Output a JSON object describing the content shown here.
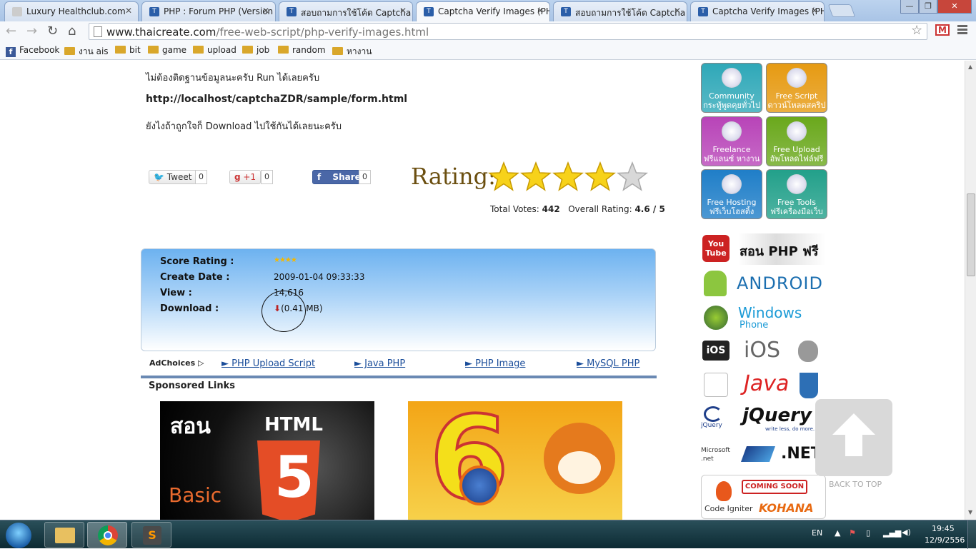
{
  "browser": {
    "tabs": [
      {
        "title": "Luxury Healthclub.com"
      },
      {
        "title": "PHP : Forum PHP (Version"
      },
      {
        "title": "สอบถามการใช้โค้ด Captcha"
      },
      {
        "title": "Captcha Verify Images (PH"
      },
      {
        "title": "สอบถามการใช้โค้ด Captcha"
      },
      {
        "title": "Captcha Verify Images (PH"
      }
    ],
    "url_domain": "www.thaicreate.com",
    "url_path": "/free-web-script/php-verify-images.html",
    "bookmarks": [
      "Facebook",
      "งาน ais",
      "bit",
      "game",
      "upload",
      "job",
      "random",
      "หางาน"
    ]
  },
  "content": {
    "line1": "ไม่ต้องติดฐานข้อมูลนะครับ Run ได้เลยครับ",
    "line2": "http://localhost/captchaZDR/sample/form.html",
    "line3": "ยังไงถ้าถูกใจก็ Download ไปใช้กันได้เลยนะครับ",
    "share": {
      "tweet": "Tweet",
      "tweet_count": "0",
      "gplus": "+1",
      "gplus_count": "0",
      "fb": "Share",
      "fb_count": "0"
    },
    "rating": {
      "label": "Rating:",
      "stars_filled": 4,
      "stars_total": 5,
      "total_votes_label": "Total Votes:",
      "total_votes": "442",
      "overall_label": "Overall Rating:",
      "overall": "4.6 / 5"
    },
    "info": {
      "score_label": "Score Rating :",
      "score_stars": 4,
      "create_label": "Create Date :",
      "create_value": "2009-01-04 09:33:33",
      "view_label": "View :",
      "view_value": "14,616",
      "download_label": "Download :",
      "download_value": "(0.41 MB)"
    },
    "adbar": {
      "adchoices": "AdChoices",
      "links": [
        "► PHP Upload Script",
        "► Java PHP",
        "► PHP Image",
        "► MySQL PHP"
      ]
    },
    "sponsored": "Sponsored Links",
    "banner1": {
      "title": "สอน",
      "word": "HTML",
      "sub": "Basic",
      "num": "5"
    },
    "banner2": {
      "num": "6"
    }
  },
  "sidebar": {
    "buttons": [
      {
        "en": "Community",
        "th": "กระทู้พูดคุยทั่วไป",
        "color": "#2fa8b8"
      },
      {
        "en": "Free Script",
        "th": "ดาวน์โหลดสคริป",
        "color": "#e69a12"
      },
      {
        "en": "Freelance",
        "th": "ฟรีแลนซ์ หางาน",
        "color": "#b844b8"
      },
      {
        "en": "Free Upload",
        "th": "อัพโหลดไฟล์ฟรี",
        "color": "#6aa81c"
      },
      {
        "en": "Free Hosting",
        "th": "ฟรีเว็บโฮสติ้ง",
        "color": "#1f7ec8"
      },
      {
        "en": "Free Tools",
        "th": "ฟรีเครื่องมือเว็บ",
        "color": "#22a08a"
      }
    ],
    "logos": [
      {
        "left": "You Tube",
        "right": "สอน PHP ฟรี"
      },
      {
        "left": "",
        "right": "ANDROID"
      },
      {
        "left": "",
        "right": "Windows",
        "sub": "Phone"
      },
      {
        "left": "iOS",
        "right": "iOS"
      },
      {
        "left": "",
        "right": "Java"
      },
      {
        "left": "jQuery",
        "right": "jQuery",
        "sub": "write less, do more."
      },
      {
        "left": "Microsoft .net",
        "right": ".NET"
      },
      {
        "left": "Code Igniter",
        "right": "COMING SOON",
        "sub": "KOHANA"
      }
    ],
    "back_to_top": "BACK TO TOP"
  },
  "taskbar": {
    "lang": "EN",
    "time": "19:45",
    "date": "12/9/2556"
  }
}
